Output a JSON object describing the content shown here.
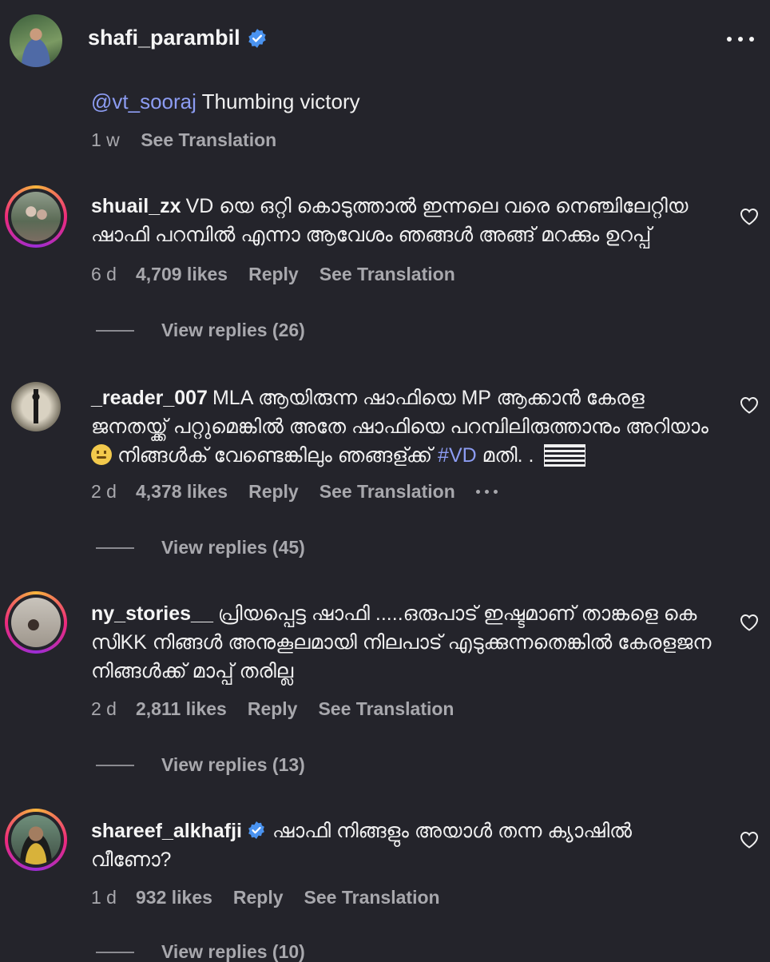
{
  "post": {
    "author": "shafi_parambil",
    "caption_mention": "@vt_sooraj",
    "caption_text": " Thumbing victory",
    "caption_time": "1 w",
    "see_translation": "See Translation"
  },
  "comments": [
    {
      "username": "shuail_zx",
      "text": "VD യെ ഒറ്റി കൊടുത്താൽ ഇന്നലെ വരെ നെഞ്ചിലേറ്റിയ ഷാഫി പറമ്പിൽ എന്നാ ആവേശം ഞങ്ങൾ അങ്ങ് മറക്കും ഉറപ്പ്",
      "time": "6 d",
      "likes": "4,709 likes",
      "reply": "Reply",
      "translate": "See Translation",
      "view_replies": "View replies (26)"
    },
    {
      "username": "_reader_007",
      "text_part1": "MLA ആയിരുന്ന ഷാഫിയെ MP ആക്കാൻ കേരള ജനതയ്ക്ക് പറ്റുമെങ്കിൽ അതേ ഷാഫിയെ പറമ്പിലിരുത്താനും അറിയാം ",
      "text_part2": " നിങ്ങൾക് വേണ്ടെങ്കിലും ഞങ്ങള്ക്ക് ",
      "hashtag": "#VD",
      "text_part3": " മതി. . ",
      "time": "2 d",
      "likes": "4,378 likes",
      "reply": "Reply",
      "translate": "See Translation",
      "view_replies": "View replies (45)"
    },
    {
      "username": "ny_stories__",
      "text": "പ്രിയപ്പെട്ട ഷാഫി .....ഒരുപാട് ഇഷ്ടമാണ് താങ്കളെ കെ സിKK നിങ്ങൾ അനുകൂലമായി നിലപാട് എടുക്കുന്നതെങ്കിൽ കേരളജന നിങ്ങൾക്ക് മാപ്പ് തരില്ല",
      "time": "2 d",
      "likes": "2,811 likes",
      "reply": "Reply",
      "translate": "See Translation",
      "view_replies": "View replies (13)"
    },
    {
      "username": "shareef_alkhafji",
      "text": "ഷാഫി നിങ്ങളും അയാൾ തന്ന ക്യാഷിൽ വീണോ?",
      "time": "1 d",
      "likes": "932 likes",
      "reply": "Reply",
      "translate": "See Translation",
      "view_replies": "View replies (10)"
    }
  ],
  "colors": {
    "background": "#24242b",
    "link": "#8c9cf2",
    "verified": "#4a93f0",
    "muted": "#a8a8ad"
  },
  "icons": [
    "verified-badge-icon",
    "more-options-icon",
    "heart-icon"
  ]
}
